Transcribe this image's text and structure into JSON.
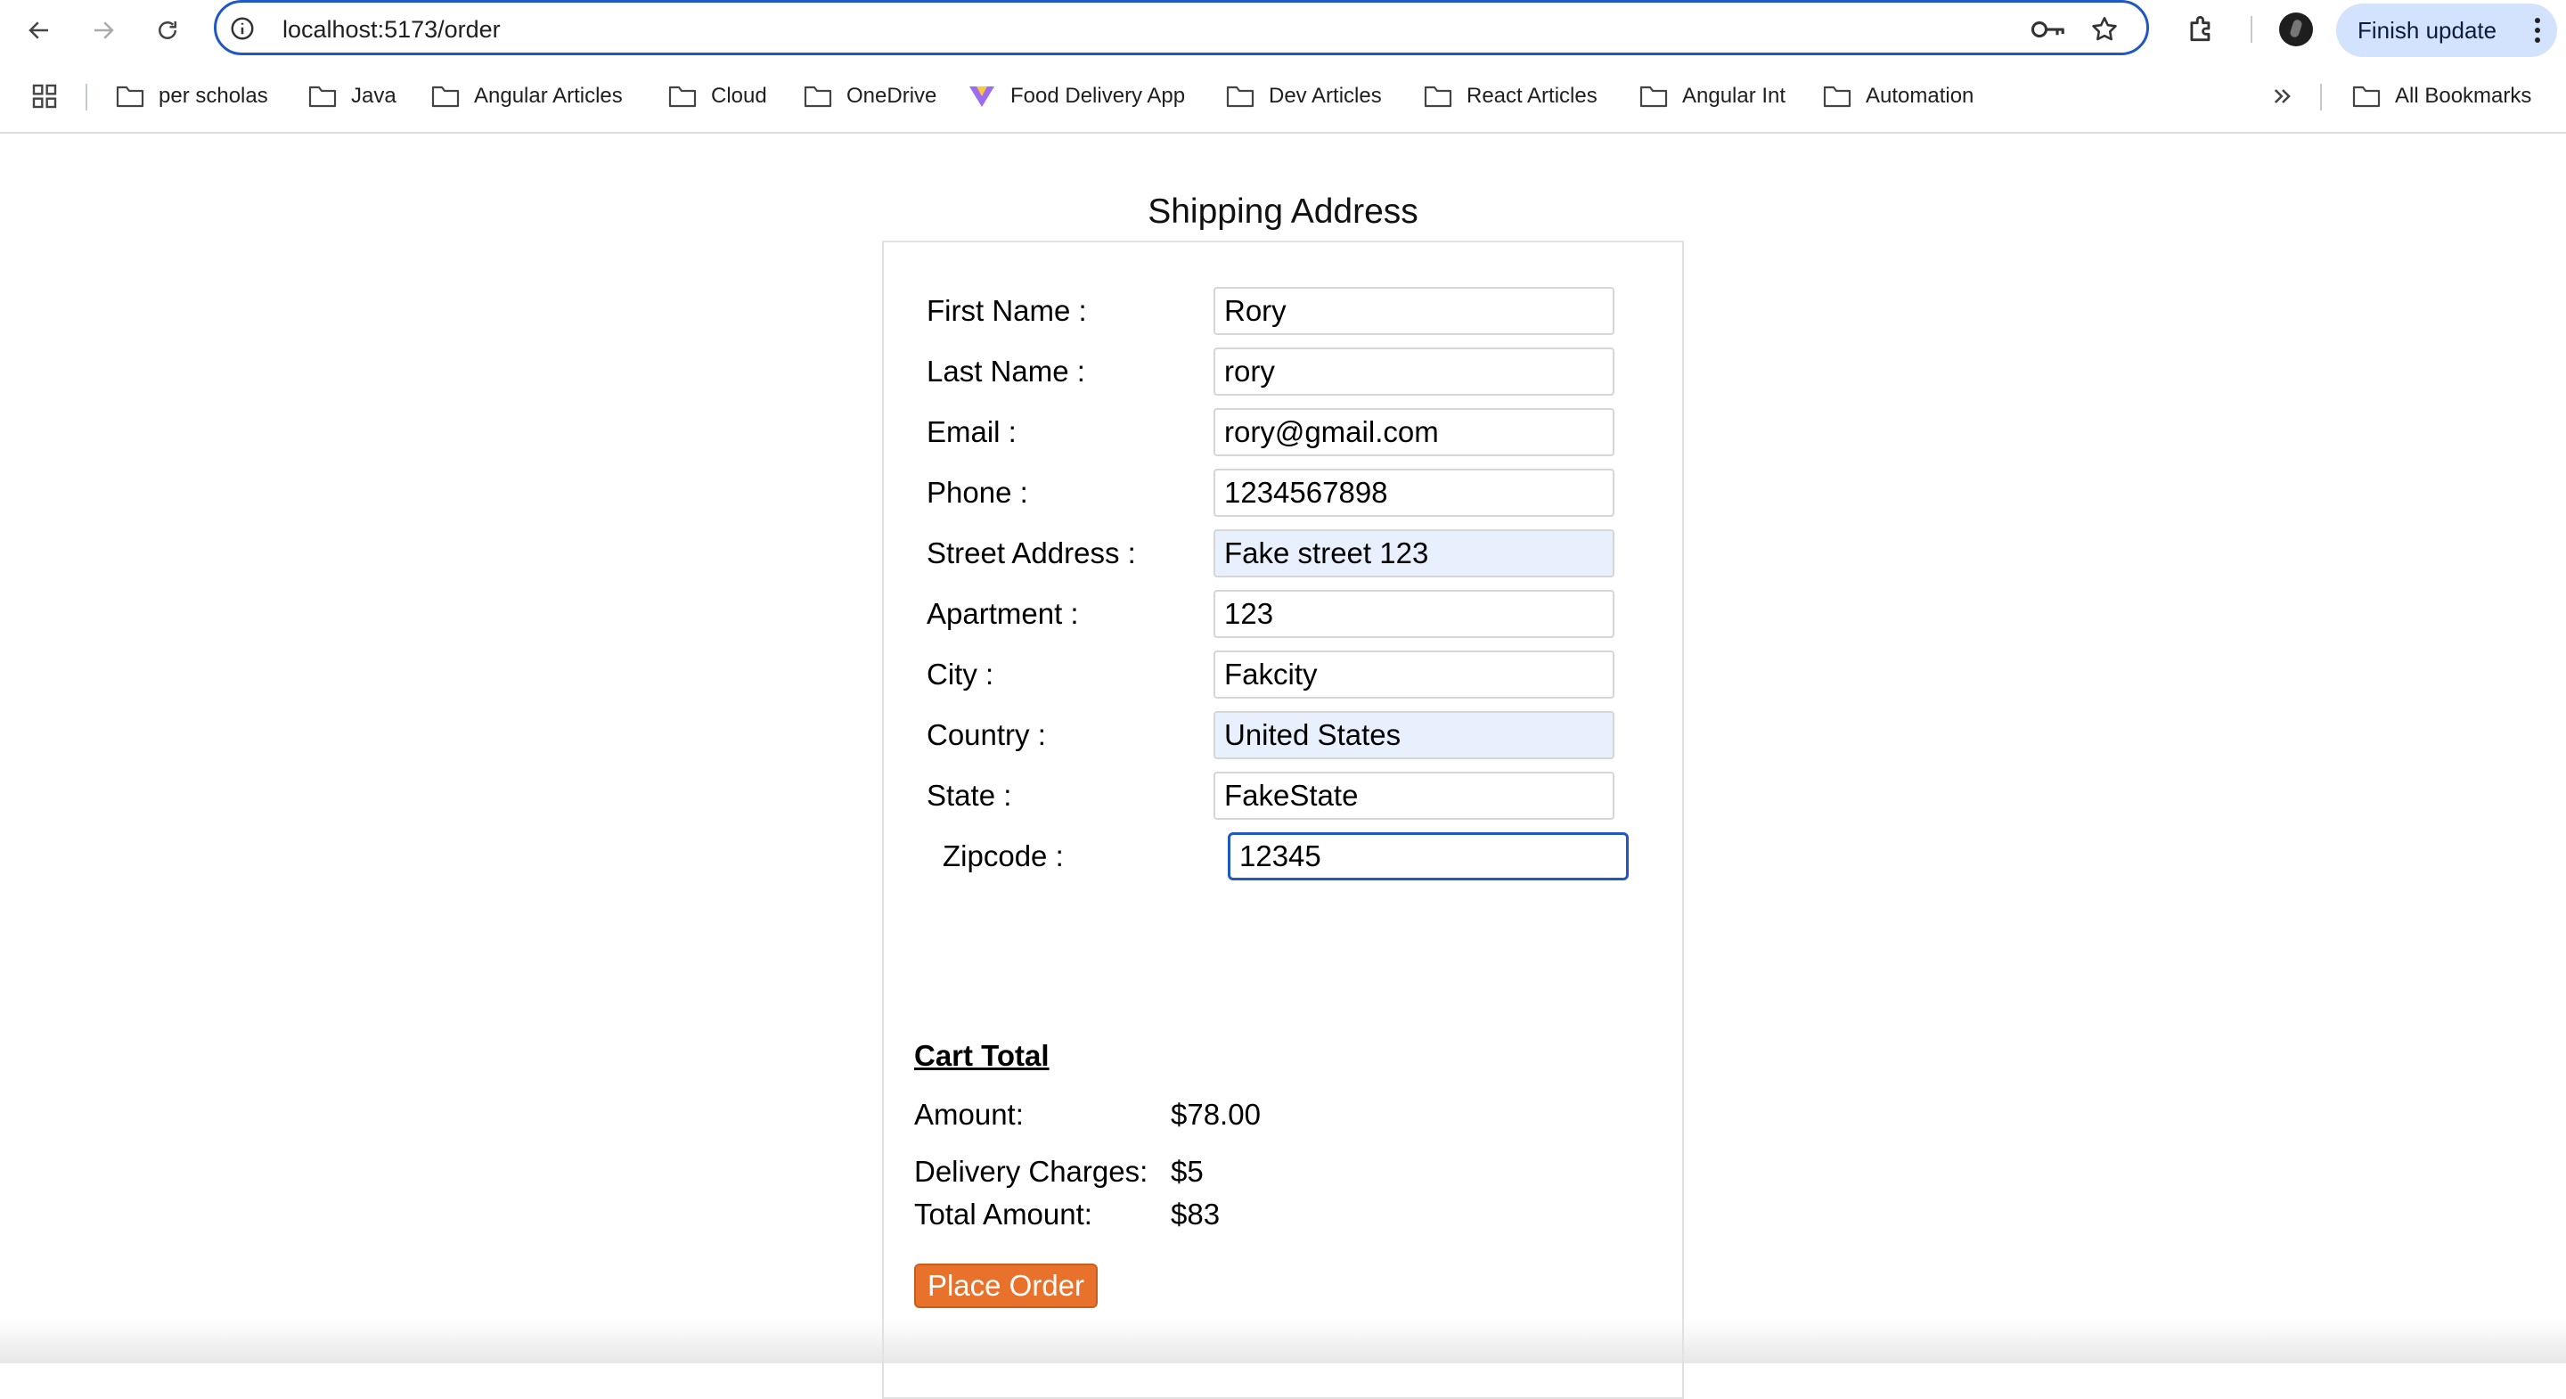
{
  "browser": {
    "url": "localhost:5173/order",
    "finish_update_label": "Finish update"
  },
  "bookmarks": [
    {
      "label": "per scholas",
      "icon": "folder-icon"
    },
    {
      "label": "Java",
      "icon": "folder-icon"
    },
    {
      "label": "Angular Articles",
      "icon": "folder-icon"
    },
    {
      "label": "Cloud",
      "icon": "folder-icon"
    },
    {
      "label": "OneDrive",
      "icon": "folder-icon"
    },
    {
      "label": "Food Delivery App",
      "icon": "vite-logo-icon"
    },
    {
      "label": "Dev Articles",
      "icon": "folder-icon"
    },
    {
      "label": "React Articles",
      "icon": "folder-icon"
    },
    {
      "label": "Angular Int",
      "icon": "folder-icon"
    },
    {
      "label": "Automation",
      "icon": "folder-icon"
    }
  ],
  "all_bookmarks_label": "All Bookmarks",
  "shipping": {
    "title": "Shipping Address",
    "fields": [
      {
        "label": "First Name :",
        "value": "Rory"
      },
      {
        "label": "Last Name :",
        "value": "rory"
      },
      {
        "label": "Email :",
        "value": "rory@gmail.com"
      },
      {
        "label": "Phone :",
        "value": "1234567898"
      },
      {
        "label": "Street Address :",
        "value": "Fake street 123"
      },
      {
        "label": "Apartment :",
        "value": "123"
      },
      {
        "label": "City :",
        "value": "Fakcity"
      },
      {
        "label": "Country :",
        "value": "United States"
      },
      {
        "label": "State :",
        "value": "FakeState"
      },
      {
        "label": "Zipcode :",
        "value": "12345"
      }
    ]
  },
  "cart": {
    "title": "Cart Total",
    "amount_label": "Amount:",
    "amount_value": "$78.00",
    "delivery_label": "Delivery Charges:",
    "delivery_value": "$5",
    "total_label": "Total Amount:",
    "total_value": "$83",
    "place_order_label": "Place Order"
  },
  "colors": {
    "accent": "#1f57c3",
    "autofill": "#e8f0fe",
    "button": "#e8722c",
    "finish_update_bg": "#d3e3fd"
  }
}
